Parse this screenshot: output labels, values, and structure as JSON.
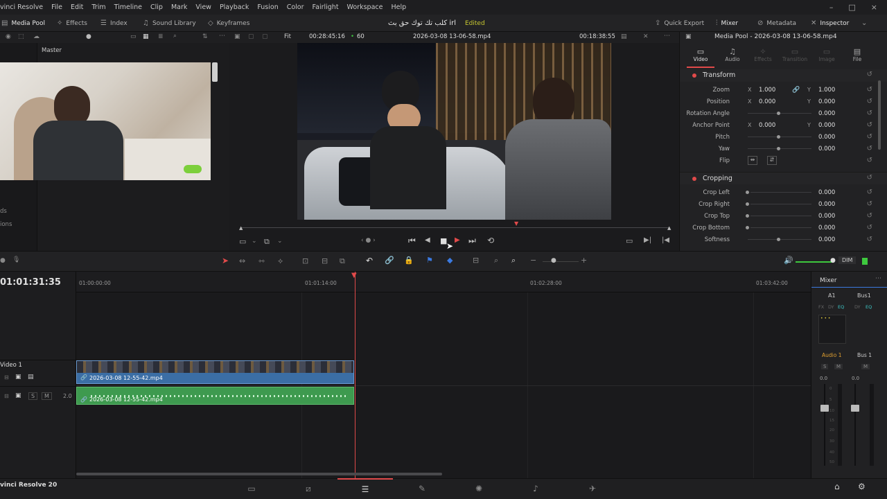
{
  "menubar": {
    "items": [
      "vinci Resolve",
      "File",
      "Edit",
      "Trim",
      "Timeline",
      "Clip",
      "Mark",
      "View",
      "Playback",
      "Fusion",
      "Color",
      "Fairlight",
      "Workspace",
      "Help"
    ],
    "window_controls": [
      "–",
      "□",
      "×"
    ]
  },
  "toolbar": {
    "media_pool": "Media Pool",
    "effects": "Effects",
    "index": "Index",
    "sound_library": "Sound Library",
    "keyframes": "Keyframes",
    "project_title": "كلب تك توك حق بث irl",
    "project_status": "Edited",
    "quick_export": "Quick Export",
    "mixer": "Mixer",
    "metadata": "Metadata",
    "inspector": "Inspector"
  },
  "viewer_bar": {
    "fit": "Fit",
    "timecode_left": "00:28:45:16",
    "fps": "60",
    "clip_name": "2026-03-08 13-06-58.mp4",
    "timecode_right": "00:18:38:55"
  },
  "media_pool": {
    "bin": "Master",
    "side_fragments": [
      "ds",
      "ions"
    ]
  },
  "inspector": {
    "title": "Media Pool - 2026-03-08 13-06-58.mp4",
    "tabs": [
      "Video",
      "Audio",
      "Effects",
      "Transition",
      "Image",
      "File"
    ],
    "transform_title": "Transform",
    "cropping_title": "Cropping",
    "zoom": {
      "label": "Zoom",
      "x": "1.000",
      "y": "1.000"
    },
    "position": {
      "label": "Position",
      "x": "0.000",
      "y": "0.000"
    },
    "rotation": {
      "label": "Rotation Angle",
      "value": "0.000"
    },
    "anchor": {
      "label": "Anchor Point",
      "x": "0.000",
      "y": "0.000"
    },
    "pitch": {
      "label": "Pitch",
      "value": "0.000"
    },
    "yaw": {
      "label": "Yaw",
      "value": "0.000"
    },
    "flip": {
      "label": "Flip"
    },
    "crop_left": {
      "label": "Crop Left",
      "value": "0.000"
    },
    "crop_right": {
      "label": "Crop Right",
      "value": "0.000"
    },
    "crop_top": {
      "label": "Crop Top",
      "value": "0.000"
    },
    "crop_bottom": {
      "label": "Crop Bottom",
      "value": "0.000"
    },
    "softness": {
      "label": "Softness",
      "value": "0.000"
    },
    "axis_x": "X",
    "axis_y": "Y"
  },
  "timeline": {
    "timecode": "01:01:31:35",
    "ruler": [
      "01:00:00:00",
      "01:01:14:00",
      "01:02:28:00",
      "01:03:42:00"
    ],
    "video_track_label": "Video 1",
    "video_clip_name": "2026-03-08 12-55-42.mp4",
    "audio_clip_name": "2026-03-08 12-55-42.mp4",
    "audio_level": "2.0",
    "track_buttons": [
      "S",
      "M"
    ],
    "volume_label": "DIM"
  },
  "mixer_panel": {
    "title": "Mixer",
    "ch1": "A1",
    "ch2": "Bus1",
    "fx_labels": [
      "FX",
      "DY",
      "EQ"
    ],
    "name1": "Audio 1",
    "name2": "Bus 1",
    "sm": [
      "S",
      "M"
    ],
    "level1": "0.0",
    "level2": "0.0",
    "scale": [
      "0",
      "5",
      "10",
      "15",
      "20",
      "30",
      "40",
      "50"
    ]
  },
  "status": {
    "app_name": "vinci Resolve 20"
  },
  "colors": {
    "accent_red": "#e14a4a",
    "video_clip": "#3b6ea5",
    "audio_clip": "#3e9a4f",
    "edited": "#c8c830"
  }
}
